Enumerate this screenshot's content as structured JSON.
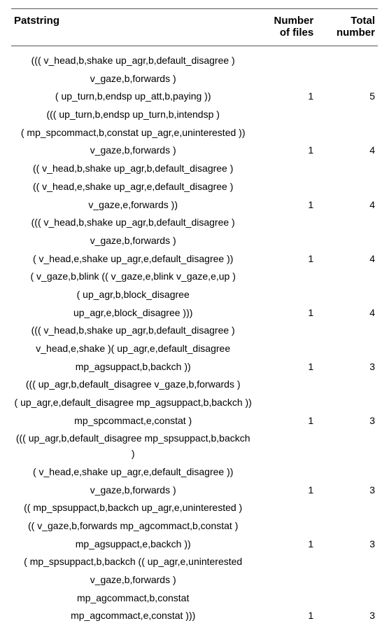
{
  "headers": {
    "col1": "Patstring",
    "col2a": "Number",
    "col2b": "of files",
    "col3a": "Total",
    "col3b": "number"
  },
  "groups": [
    {
      "lines": [
        "((( v_head,b,shake up_agr,b,default_disagree )",
        "v_gaze,b,forwards )",
        "( up_turn,b,endsp up_att,b,paying ))"
      ],
      "files": "1",
      "total": "5"
    },
    {
      "lines": [
        "((( up_turn,b,endsp up_turn,b,intendsp )",
        "( mp_spcommact,b,constat up_agr,e,uninterested ))",
        "v_gaze,b,forwards )"
      ],
      "files": "1",
      "total": "4"
    },
    {
      "lines": [
        "(( v_head,b,shake up_agr,b,default_disagree )",
        "(( v_head,e,shake up_agr,e,default_disagree )",
        "v_gaze,e,forwards ))"
      ],
      "files": "1",
      "total": "4"
    },
    {
      "lines": [
        "((( v_head,b,shake up_agr,b,default_disagree )",
        "v_gaze,b,forwards )",
        "( v_head,e,shake up_agr,e,default_disagree ))"
      ],
      "files": "1",
      "total": "4"
    },
    {
      "lines": [
        "( v_gaze,b,blink (( v_gaze,e,blink v_gaze,e,up )",
        "( up_agr,b,block_disagree",
        "up_agr,e,block_disagree )))"
      ],
      "files": "1",
      "total": "4"
    },
    {
      "lines": [
        "((( v_head,b,shake up_agr,b,default_disagree )",
        "v_head,e,shake )( up_agr,e,default_disagree",
        "mp_agsuppact,b,backch ))"
      ],
      "files": "1",
      "total": "3"
    },
    {
      "lines": [
        "((( up_agr,b,default_disagree v_gaze,b,forwards )",
        "( up_agr,e,default_disagree mp_agsuppact,b,backch ))",
        "mp_spcommact,e,constat )"
      ],
      "files": "1",
      "total": "3"
    },
    {
      "lines": [
        "((( up_agr,b,default_disagree mp_spsuppact,b,backch )",
        "( v_head,e,shake up_agr,e,default_disagree ))",
        "v_gaze,b,forwards )"
      ],
      "files": "1",
      "total": "3"
    },
    {
      "lines": [
        "(( mp_spsuppact,b,backch up_agr,e,uninterested )",
        "(( v_gaze,b,forwards mp_agcommact,b,constat )",
        "mp_agsuppact,e,backch ))"
      ],
      "files": "1",
      "total": "3"
    },
    {
      "lines": [
        "( mp_spsuppact,b,backch (( up_agr,e,uninterested",
        "v_gaze,b,forwards )",
        "mp_agcommact,b,constat",
        "mp_agcommact,e,constat )))"
      ],
      "files": "1",
      "total": "3"
    }
  ]
}
